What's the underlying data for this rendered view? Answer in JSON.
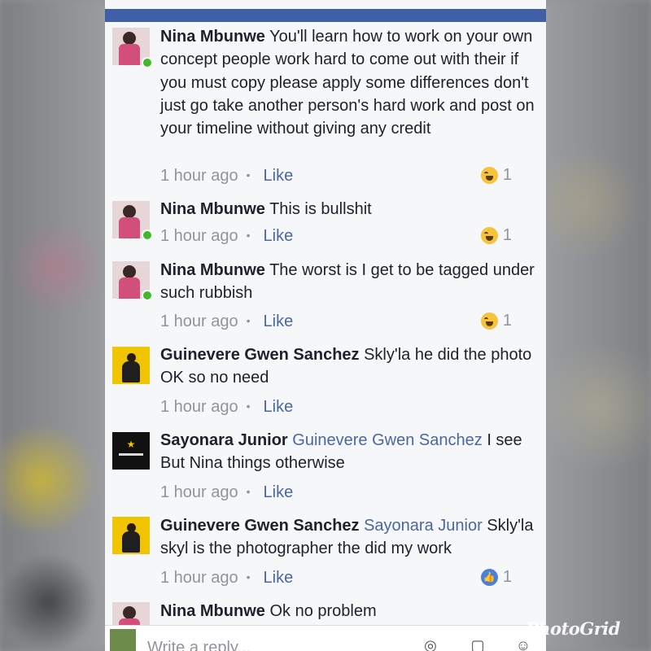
{
  "comments": [
    {
      "author": "Nina Mbunwe",
      "mention": "",
      "text": "You'll learn how to work on your own concept people work hard to come out with their if you must copy please apply some differences don't just go take another person's hard work and post on your timeline without giving any credit",
      "time": "1 hour ago",
      "like": "Like",
      "reaction_count": "1",
      "reaction": "haha",
      "online": true
    },
    {
      "author": "Nina Mbunwe",
      "mention": "",
      "text": "This is bullshit",
      "time": "1 hour ago",
      "like": "Like",
      "reaction_count": "1",
      "reaction": "haha",
      "online": true
    },
    {
      "author": "Nina Mbunwe",
      "mention": "",
      "text": "The worst is I get to be tagged under such rubbish",
      "time": "1 hour ago",
      "like": "Like",
      "reaction_count": "1",
      "reaction": "haha",
      "online": true
    },
    {
      "author": "Guinevere Gwen Sanchez",
      "mention": "",
      "text": "Skly'la he did the photo OK so no need",
      "time": "1 hour ago",
      "like": "Like",
      "online": false
    },
    {
      "author": "Sayonara Junior",
      "mention": "Guinevere Gwen Sanchez",
      "text": "I see But Nina things otherwise",
      "time": "1 hour ago",
      "like": "Like",
      "online": false
    },
    {
      "author": "Guinevere Gwen Sanchez",
      "mention": "Sayonara Junior",
      "text": "Skly'la skyl is the photographer the did my work",
      "time": "1 hour ago",
      "like": "Like",
      "reaction_count": "1",
      "reaction": "like",
      "online": false
    },
    {
      "author": "Nina Mbunwe",
      "mention": "",
      "text": "Ok no problem",
      "online": true
    }
  ],
  "reply": {
    "placeholder": "Write a reply..."
  },
  "watermark": "PhotoGrid",
  "colors": {
    "header": "#3f5fa8",
    "link": "#4b67a1",
    "online": "#42b72a"
  }
}
